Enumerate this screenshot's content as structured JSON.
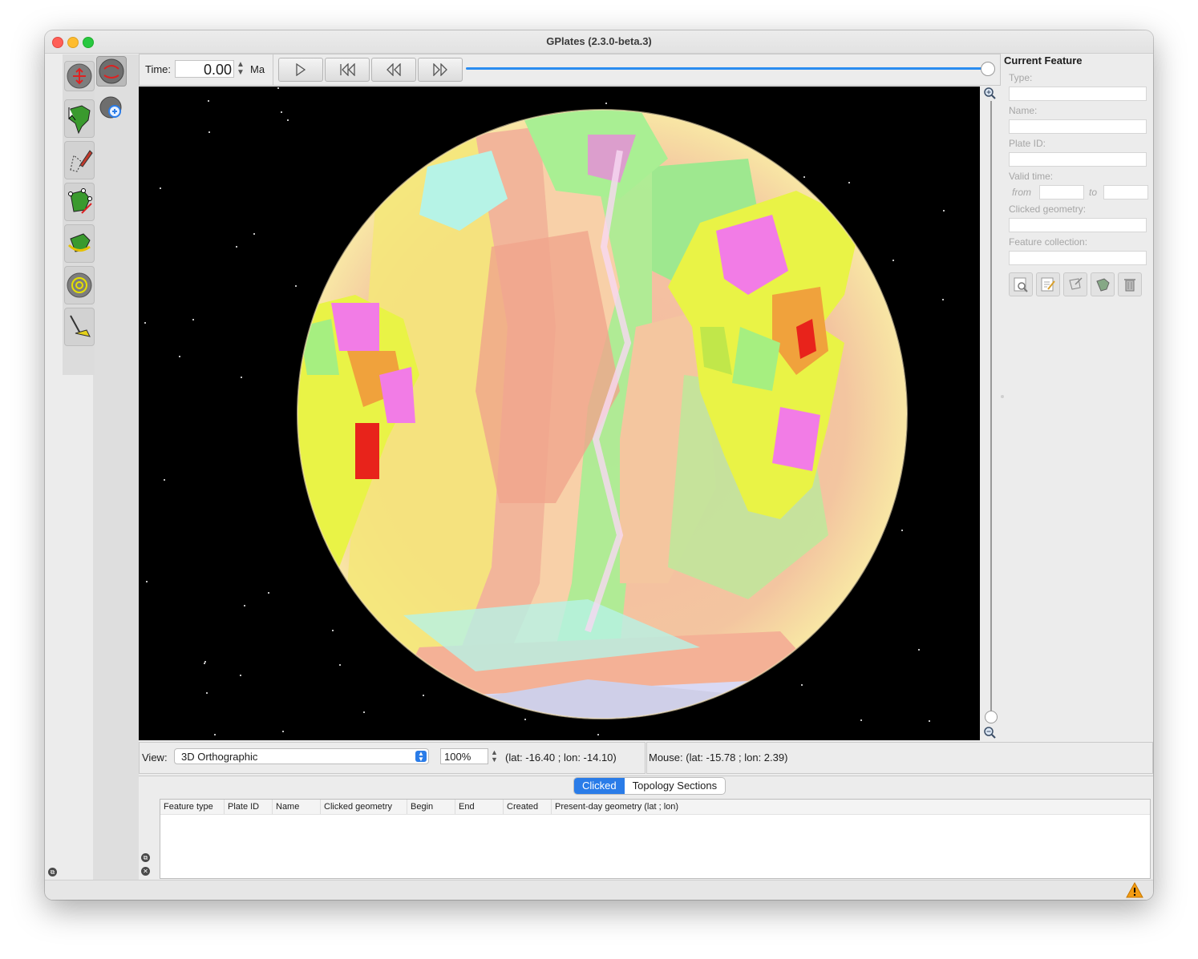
{
  "window": {
    "title": "GPlates (2.3.0-beta.3)"
  },
  "time": {
    "label": "Time:",
    "value": "0.00",
    "unit": "Ma"
  },
  "animation": {
    "slider_fraction": 1.0
  },
  "current_feature": {
    "title": "Current Feature",
    "type_label": "Type:",
    "name_label": "Name:",
    "plate_id_label": "Plate ID:",
    "valid_time_label": "Valid time:",
    "from_label": "from",
    "to_label": "to",
    "clicked_geometry_label": "Clicked geometry:",
    "feature_collection_label": "Feature collection:"
  },
  "view": {
    "label": "View:",
    "projection": "3D Orthographic",
    "zoom": "100%",
    "camera_coords": "(lat: -16.40 ; lon: -14.10)"
  },
  "mouse": {
    "text": "Mouse: (lat: -15.78 ; lon: 2.39)"
  },
  "tabs": [
    {
      "label": "Clicked",
      "selected": true
    },
    {
      "label": "Topology Sections",
      "selected": false
    }
  ],
  "table": {
    "columns": [
      "Feature type",
      "Plate ID",
      "Name",
      "Clicked geometry",
      "Begin",
      "End",
      "Created",
      "Present-day geometry (lat ; lon)"
    ]
  },
  "colors": {
    "accent": "#2a7ce8",
    "globe_background": "#000000"
  }
}
